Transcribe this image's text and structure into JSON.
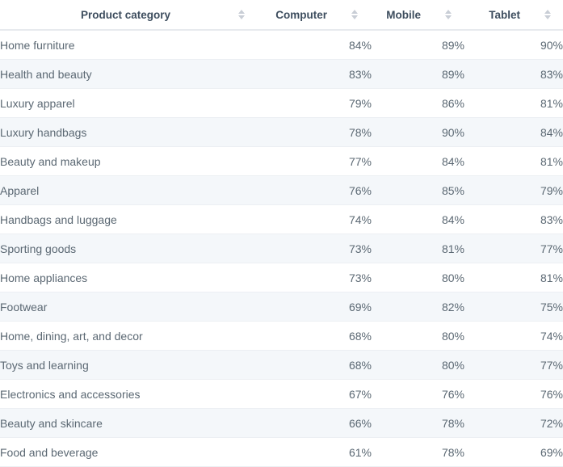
{
  "table": {
    "columns": [
      {
        "key": "category",
        "label": "Product category",
        "align": "left",
        "sort_icon": "sort-updown-icon"
      },
      {
        "key": "computer",
        "label": "Computer",
        "align": "right",
        "sort_icon": "sort-updown-icon"
      },
      {
        "key": "mobile",
        "label": "Mobile",
        "align": "right",
        "sort_icon": "sort-updown-icon"
      },
      {
        "key": "tablet",
        "label": "Tablet",
        "align": "right",
        "sort_icon": "sort-updown-icon"
      }
    ],
    "rows": [
      {
        "category": "Home furniture",
        "computer": "84%",
        "mobile": "89%",
        "tablet": "90%"
      },
      {
        "category": "Health and beauty",
        "computer": "83%",
        "mobile": "89%",
        "tablet": "83%"
      },
      {
        "category": "Luxury apparel",
        "computer": "79%",
        "mobile": "86%",
        "tablet": "81%"
      },
      {
        "category": "Luxury handbags",
        "computer": "78%",
        "mobile": "90%",
        "tablet": "84%"
      },
      {
        "category": "Beauty and makeup",
        "computer": "77%",
        "mobile": "84%",
        "tablet": "81%"
      },
      {
        "category": "Apparel",
        "computer": "76%",
        "mobile": "85%",
        "tablet": "79%"
      },
      {
        "category": "Handbags and luggage",
        "computer": "74%",
        "mobile": "84%",
        "tablet": "83%"
      },
      {
        "category": "Sporting goods",
        "computer": "73%",
        "mobile": "81%",
        "tablet": "77%"
      },
      {
        "category": "Home appliances",
        "computer": "73%",
        "mobile": "80%",
        "tablet": "81%"
      },
      {
        "category": "Footwear",
        "computer": "69%",
        "mobile": "82%",
        "tablet": "75%"
      },
      {
        "category": "Home, dining, art, and decor",
        "computer": "68%",
        "mobile": "80%",
        "tablet": "74%"
      },
      {
        "category": "Toys and learning",
        "computer": "68%",
        "mobile": "80%",
        "tablet": "77%"
      },
      {
        "category": "Electronics and accessories",
        "computer": "67%",
        "mobile": "76%",
        "tablet": "76%"
      },
      {
        "category": "Beauty and skincare",
        "computer": "66%",
        "mobile": "78%",
        "tablet": "72%"
      },
      {
        "category": "Food and beverage",
        "computer": "61%",
        "mobile": "78%",
        "tablet": "69%"
      }
    ]
  },
  "colors": {
    "header_text": "#3d4d5e",
    "body_text": "#5b6873",
    "stripe": "#f4f7fa",
    "row_border": "#eceff3",
    "header_border": "#e7eaee",
    "sort_icon": "#c9ced6"
  }
}
